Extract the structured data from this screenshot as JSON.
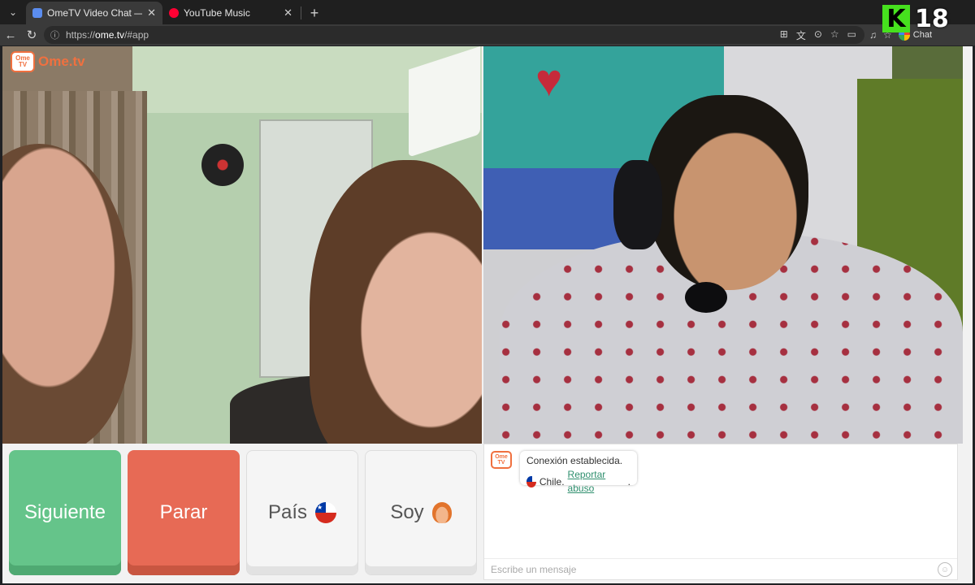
{
  "browser": {
    "tabs": [
      {
        "title": "OmeTV Video Chat — Omegl",
        "active": true,
        "favicon_color": "#5b8def"
      },
      {
        "title": "YouTube Music",
        "active": false,
        "favicon_color": "#ff0033"
      }
    ],
    "url_scheme": "https://",
    "url_host": "ome.tv",
    "url_path": "/#app",
    "chat_label": "Chat"
  },
  "watermark": {
    "letter": "K",
    "age": "18"
  },
  "app": {
    "logo_tv": "Ome TV",
    "logo_text": "Ome.tv",
    "buttons": {
      "next": "Siguiente",
      "stop": "Parar",
      "country": "País",
      "gender": "Soy"
    },
    "chat": {
      "system_line1": "Conexión establecida.",
      "country": "Chile.",
      "report": "Reportar abuso",
      "report_suffix": ".",
      "placeholder": "Escribe un mensaje"
    }
  },
  "colors": {
    "next": "#65c48a",
    "stop": "#e76a55",
    "brand": "#f0703f"
  }
}
